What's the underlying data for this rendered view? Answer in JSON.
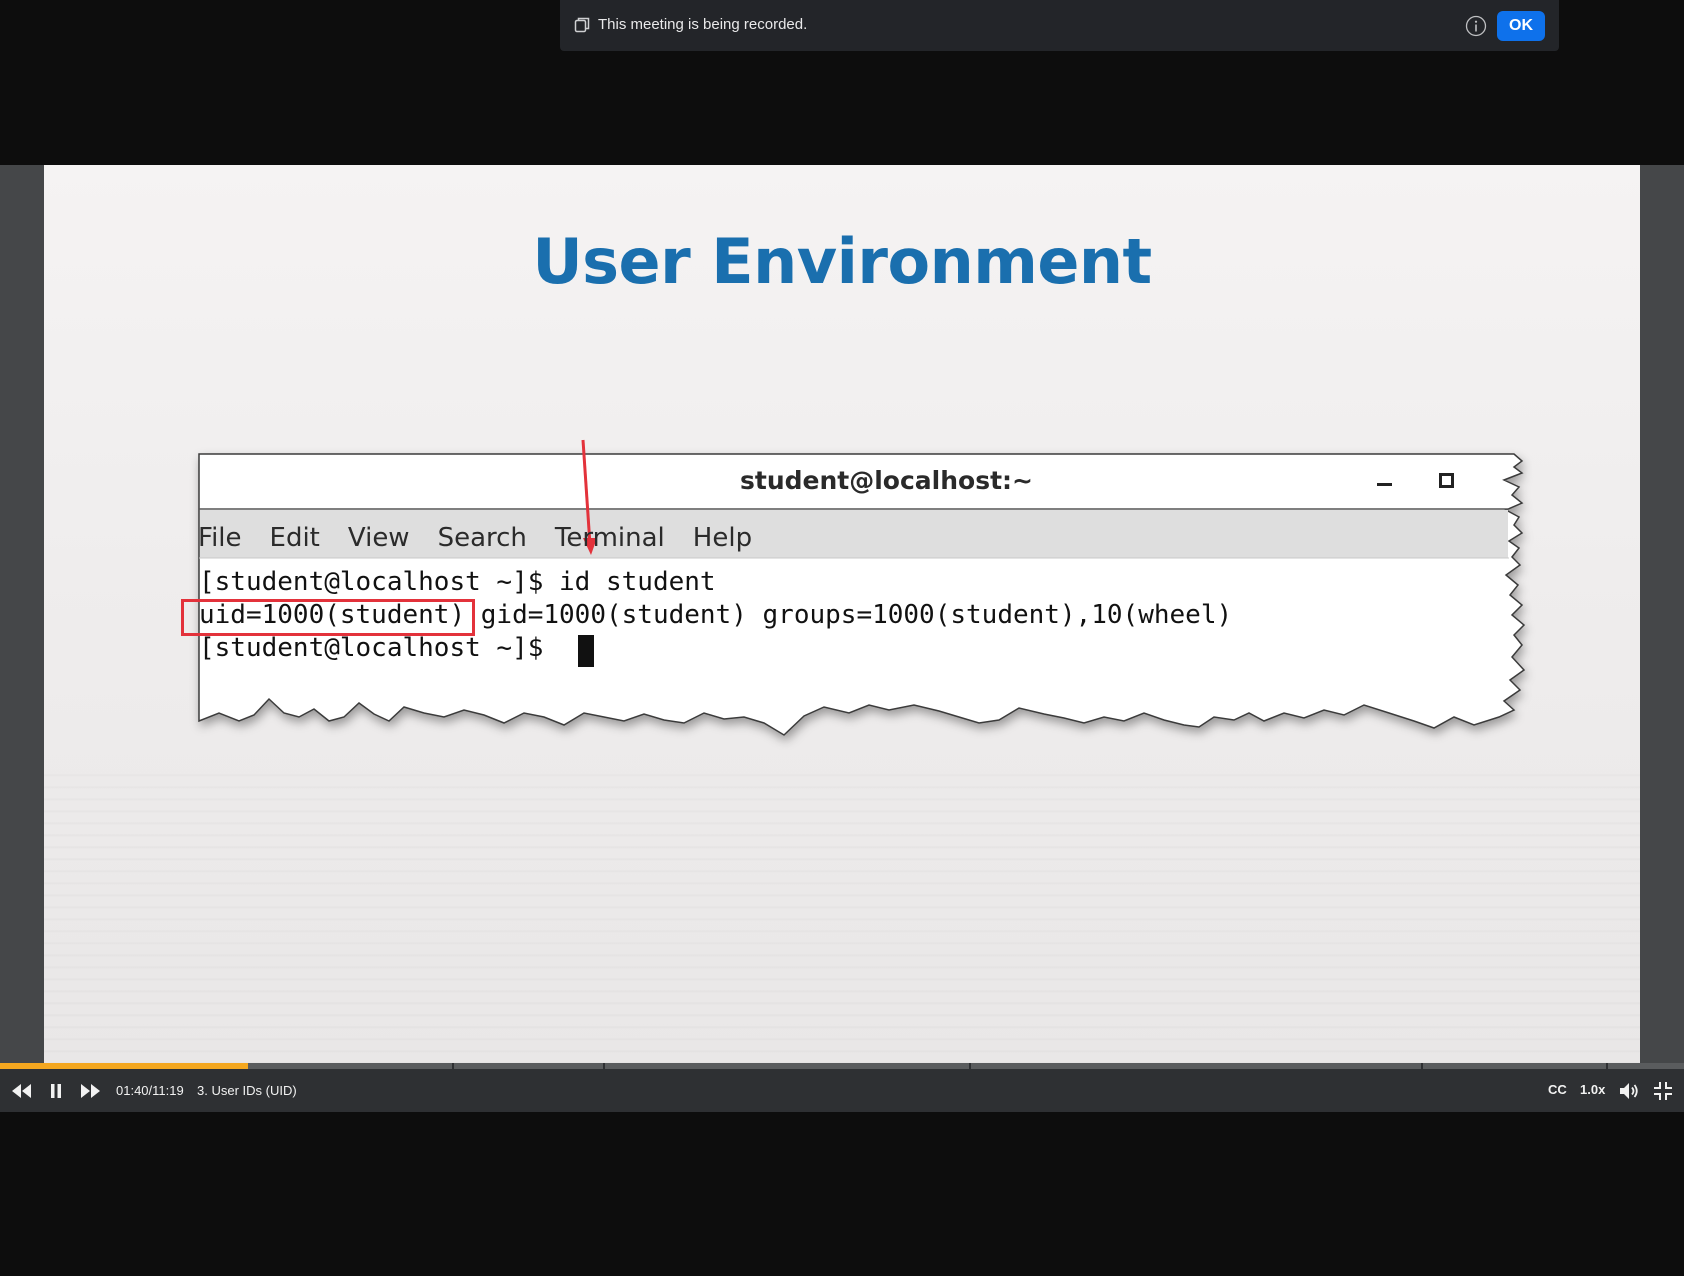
{
  "recording_banner": {
    "message": "This meeting is being recorded.",
    "ok_label": "OK",
    "icon": "recording-icon",
    "info_icon": "info-icon"
  },
  "slide": {
    "title": "User Environment",
    "terminal": {
      "window_title": "student@localhost:~",
      "menu": [
        "File",
        "Edit",
        "View",
        "Search",
        "Terminal",
        "Help"
      ],
      "lines": [
        "[student@localhost ~]$ id student",
        "uid=1000(student) gid=1000(student) groups=1000(student),10(wheel)",
        "[student@localhost ~]$ "
      ]
    },
    "accent_color": "#1a6fae",
    "highlight_color": "#e3323b"
  },
  "player": {
    "time": "01:40/11:19",
    "chapter_title": "3. User IDs (UID)",
    "progress_fraction": 0.147,
    "cc_label": "CC",
    "speed_label": "1.0x",
    "progress_color": "#f4a71f",
    "icons": [
      "rewind-icon",
      "pause-icon",
      "forward-icon",
      "volume-icon",
      "exit-fullscreen-icon"
    ]
  }
}
